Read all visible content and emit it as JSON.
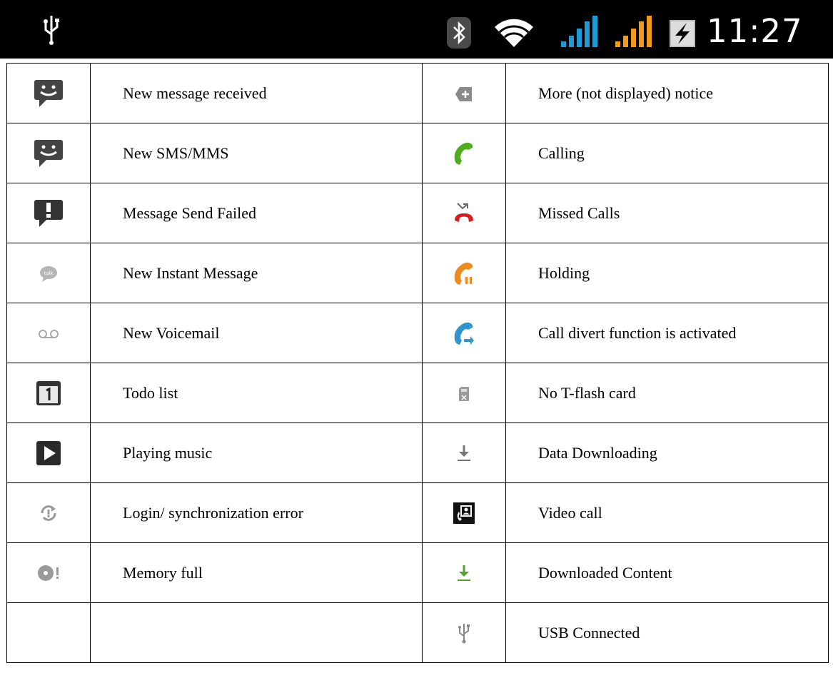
{
  "status_bar": {
    "time": "11:27",
    "icons": [
      "usb-icon",
      "bluetooth-icon",
      "wifi-icon",
      "signal-sim1-icon",
      "signal-sim2-icon",
      "battery-charging-icon"
    ],
    "colors": {
      "background": "#000000",
      "signal_sim1": "#1e9bd7",
      "signal_sim2": "#f29a1e"
    }
  },
  "rows": [
    {
      "left_icon": "new-message-icon",
      "left_label": "New message received",
      "right_icon": "more-notice-icon",
      "right_label": "More (not displayed) notice"
    },
    {
      "left_icon": "new-sms-mms-icon",
      "left_label": "New SMS/MMS",
      "right_icon": "calling-icon",
      "right_label": "Calling"
    },
    {
      "left_icon": "message-failed-icon",
      "left_label": "Message Send Failed",
      "right_icon": "missed-call-icon",
      "right_label": "Missed Calls"
    },
    {
      "left_icon": "instant-message-icon",
      "left_label": "New Instant Message",
      "right_icon": "call-holding-icon",
      "right_label": "Holding"
    },
    {
      "left_icon": "voicemail-icon",
      "left_label": "New Voicemail",
      "right_icon": "call-divert-icon",
      "right_label": "Call divert function is activated"
    },
    {
      "left_icon": "calendar-todo-icon",
      "left_label": "Todo list",
      "right_icon": "no-sd-card-icon",
      "right_label": "No T-flash card"
    },
    {
      "left_icon": "play-music-icon",
      "left_label": "Playing music",
      "right_icon": "downloading-icon",
      "right_label": "Data Downloading"
    },
    {
      "left_icon": "sync-error-icon",
      "left_label": "Login/ synchronization error",
      "right_icon": "video-call-icon",
      "right_label": "Video call"
    },
    {
      "left_icon": "memory-full-icon",
      "left_label": "Memory full",
      "right_icon": "downloaded-icon",
      "right_label": "Downloaded Content"
    },
    {
      "left_icon": "",
      "left_label": "",
      "right_icon": "usb-connected-icon",
      "right_label": "USB Connected"
    }
  ]
}
